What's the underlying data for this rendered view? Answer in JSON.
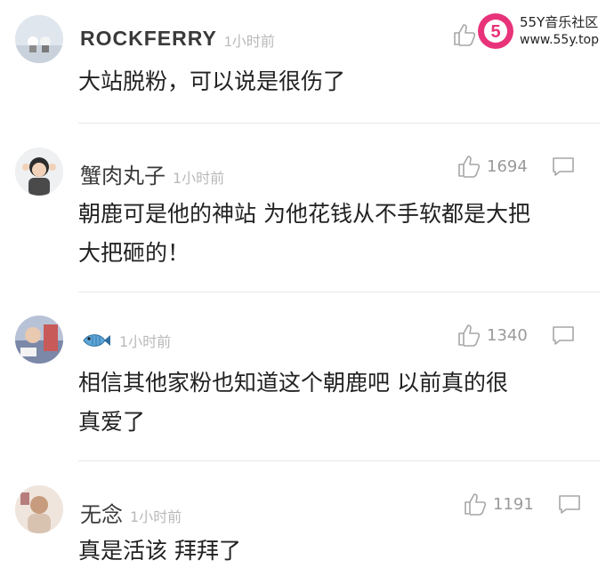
{
  "watermark": {
    "name": "55Y音乐社区",
    "url": "www.55y.top",
    "badge": "5"
  },
  "comments": [
    {
      "username": "ROCKFERRY",
      "time": "1小时前",
      "likes": "",
      "lines": [
        "大站脱粉，可以说是很伤了"
      ]
    },
    {
      "username": "蟹肉丸子",
      "time": "1小时前",
      "likes": "1694",
      "lines": [
        "朝鹿可是他的神站 为他花钱从不手软都是大把",
        "大把砸的！"
      ]
    },
    {
      "username": "",
      "username_icon": "fish-emoji-icon",
      "time": "1小时前",
      "likes": "1340",
      "lines": [
        "相信其他家粉也知道这个朝鹿吧  以前真的很",
        "真爱了"
      ]
    },
    {
      "username": "无念",
      "time": "1小时前",
      "likes": "1191",
      "lines": [
        "真是活该 拜拜了"
      ]
    }
  ],
  "colors": {
    "text": "#222222",
    "meta": "#b9b9b9",
    "count": "#9a9a9a",
    "divider": "#e6e6e6",
    "logo_pink": "#e8337a"
  }
}
